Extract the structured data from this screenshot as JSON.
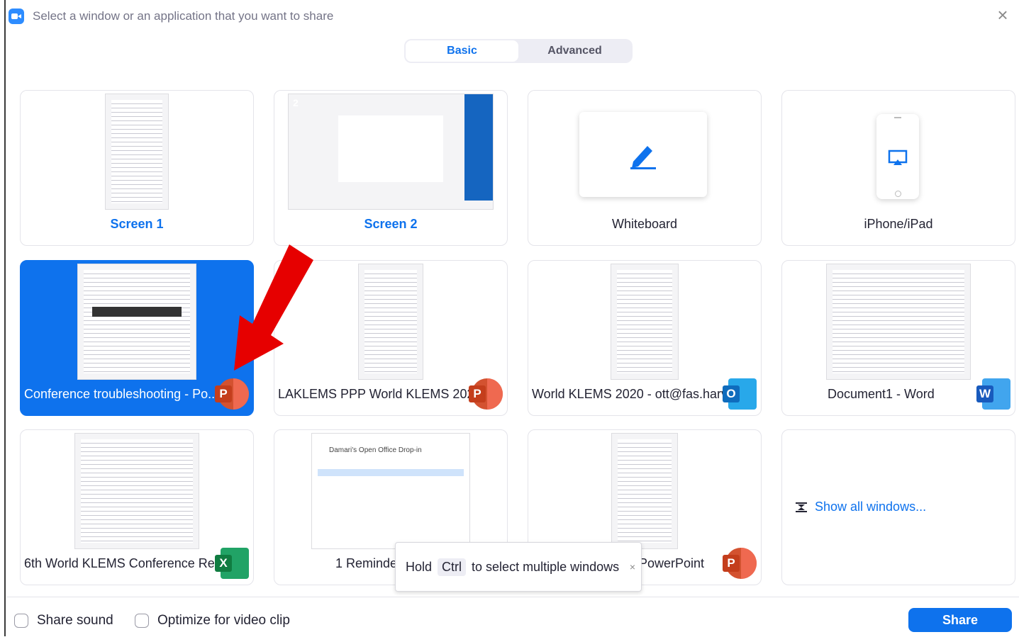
{
  "window": {
    "title": "Select a window or an application that you want to share"
  },
  "tabs": [
    {
      "label": "Basic",
      "active": true
    },
    {
      "label": "Advanced",
      "active": false
    }
  ],
  "tiles": {
    "screen1": {
      "label": "Screen 1"
    },
    "screen2": {
      "label": "Screen 2",
      "badge": "2"
    },
    "whiteboard": {
      "label": "Whiteboard"
    },
    "iphone": {
      "label": "iPhone/iPad"
    },
    "conf": {
      "label": "Conference troubleshooting - Po...",
      "app": "P"
    },
    "laklems": {
      "label": "LAKLEMS PPP World KLEMS 2021...",
      "app": "P"
    },
    "world2020": {
      "label": "World KLEMS 2020 - ott@fas.harv...",
      "app": "O"
    },
    "doc1": {
      "label": "Document1 - Word",
      "app": "W"
    },
    "excel": {
      "label": "6th World KLEMS Conference Re...",
      "app": "X"
    },
    "reminder": {
      "label": "1 Reminder"
    },
    "ppt": {
      "label": "PowerPoint",
      "app": "P"
    },
    "showall": {
      "label": "Show all windows..."
    }
  },
  "thumbnail_text": {
    "reminder_title": "Damari's Open Office Drop-in"
  },
  "tooltip": {
    "pre": "Hold",
    "key": "Ctrl",
    "post": "to select multiple windows",
    "close": "×"
  },
  "footer": {
    "share_sound": "Share sound",
    "optimize": "Optimize for video clip",
    "share": "Share"
  },
  "colors": {
    "accent": "#0e72ed",
    "ppt": "#d35230",
    "outlook": "#0f6cbd",
    "word": "#185abd",
    "excel": "#107c41",
    "arrow": "#e60000"
  }
}
